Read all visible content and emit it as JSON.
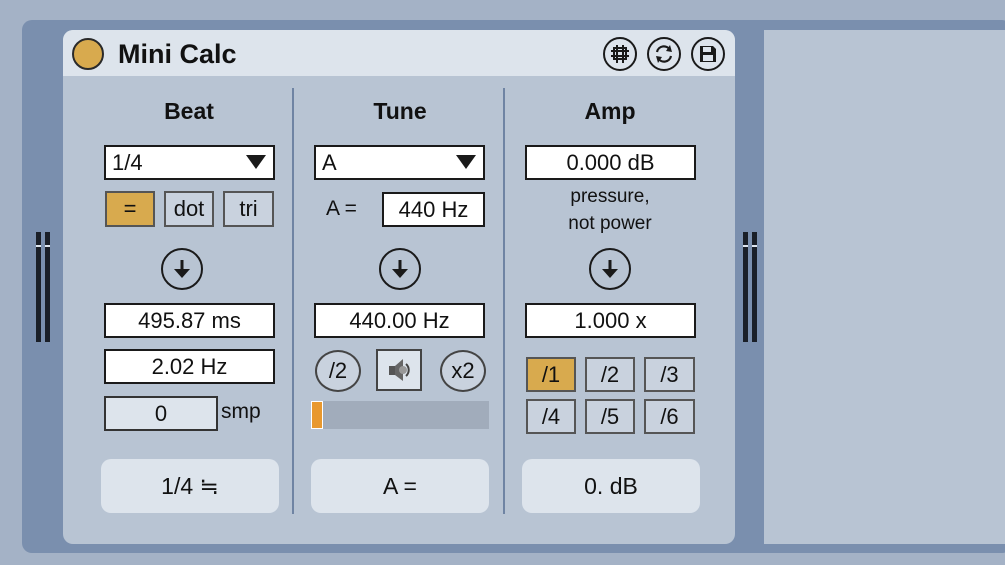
{
  "device": {
    "title": "Mini Calc"
  },
  "beat": {
    "title": "Beat",
    "division": "1/4",
    "modes": [
      "=",
      "dot",
      "tri"
    ],
    "ms": "495.87 ms",
    "hz": "2.02 Hz",
    "samples": "0",
    "samples_unit": "smp",
    "bottom": "1/4 ≒"
  },
  "tune": {
    "title": "Tune",
    "note": "A",
    "ref_label": "A =",
    "ref_value": "440 Hz",
    "freq": "440.00 Hz",
    "half": "/2",
    "double": "x2",
    "bottom": "A =",
    "level": 0.05
  },
  "amp": {
    "title": "Amp",
    "db": "0.000 dB",
    "note_line1": "pressure,",
    "note_line2": "not power",
    "factor": "1.000 x",
    "divisors": [
      "/1",
      "/2",
      "/3",
      "/4",
      "/5",
      "/6"
    ],
    "bottom": "0. dB"
  },
  "colors": {
    "accent": "#d8aa4e",
    "panel": "#b8c4d3",
    "frame": "#7a8fae",
    "slider_fill": "#e8982e"
  },
  "icons": [
    "power-icon",
    "freeze-icon",
    "hot-swap-icon",
    "save-icon",
    "arrow-down-icon",
    "speaker-icon"
  ]
}
